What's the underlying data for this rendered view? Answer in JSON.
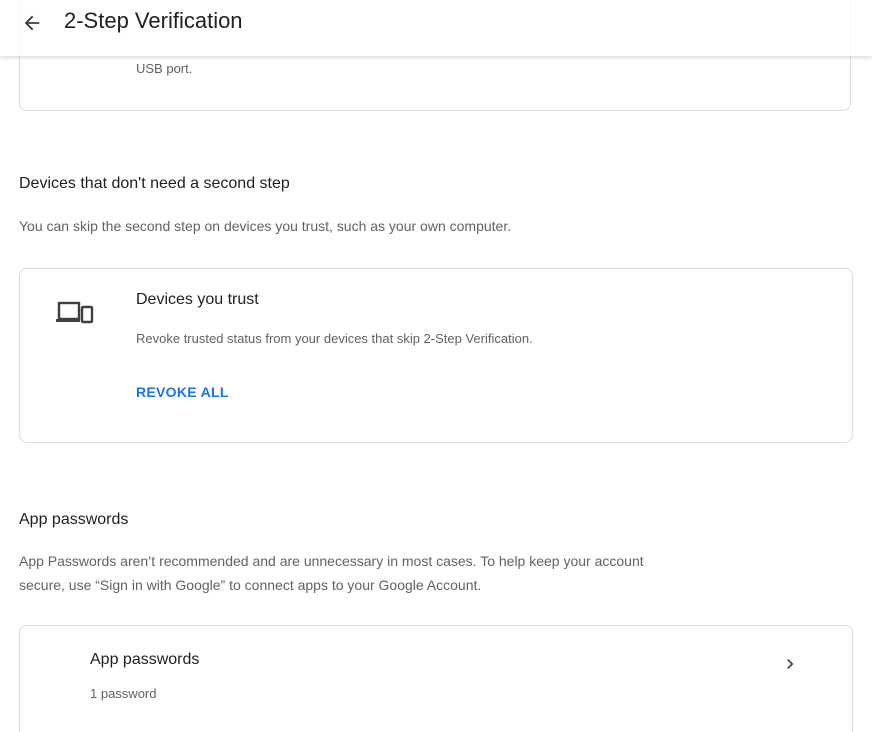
{
  "header": {
    "back_icon": "arrow-back-icon",
    "title": "2-Step Verification"
  },
  "top_card": {
    "tail_text": "USB port."
  },
  "devices_section": {
    "title": "Devices that don't need a second step",
    "description": "You can skip the second step on devices you trust, such as your own computer.",
    "card": {
      "icon": "devices-icon",
      "title": "Devices you trust",
      "subtitle": "Revoke trusted status from your devices that skip 2-Step Verification.",
      "action_label": "REVOKE ALL"
    }
  },
  "app_passwords_section": {
    "title": "App passwords",
    "description_line1": "App Passwords aren’t recommended and are unnecessary in most cases. To help keep your account",
    "description_line2": "secure, use “Sign in with Google” to connect apps to your Google Account.",
    "card": {
      "title": "App passwords",
      "subtitle": "1 password",
      "icon": "chevron-right-icon"
    }
  },
  "colors": {
    "accent": "#1a73e8",
    "text_primary": "#202124",
    "text_secondary": "#5f6368",
    "border": "#dadce0"
  }
}
